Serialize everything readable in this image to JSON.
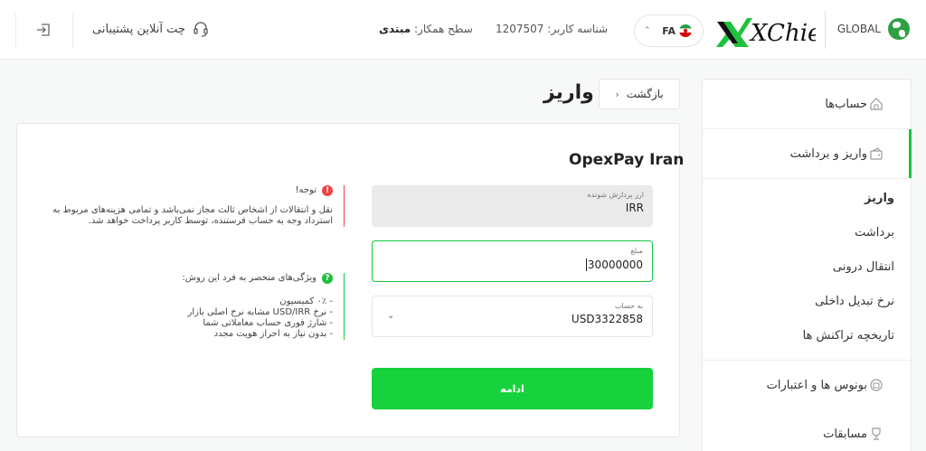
{
  "header": {
    "global_label": "GLOBAL",
    "logo_text": "XChief",
    "language": "FA",
    "user_id_label": "شناسه کاربر:",
    "user_id": "1207507",
    "partner_level_label": "سطح همکار:",
    "partner_level": "مبتدی",
    "support_label": "چت آنلاین پشتیبانی"
  },
  "sidebar": {
    "items": [
      {
        "label": "حساب‌ها",
        "icon": "home-icon"
      },
      {
        "label": "واریز و برداشت",
        "icon": "wallet-icon"
      }
    ],
    "sub_items": [
      {
        "label": "واریز"
      },
      {
        "label": "برداشت"
      },
      {
        "label": "انتقال درونی"
      },
      {
        "label": "نرخ تبدیل داخلی"
      },
      {
        "label": "تاریخچه تراکنش ها"
      }
    ],
    "bottom_items": [
      {
        "label": "بونوس ها و اعتبارات",
        "icon": "bonus-icon"
      },
      {
        "label": "مسابقات",
        "icon": "trophy-icon"
      }
    ]
  },
  "page": {
    "title": "واریز",
    "back_label": "بازگشت"
  },
  "form": {
    "title": "OpexPay Iran",
    "currency_label": "ارز پردازش شونده",
    "currency_value": "IRR",
    "amount_label": "مبلغ",
    "amount_value": "30000000",
    "account_label": "به حساب",
    "account_value": "USD3322858",
    "continue_label": "ادامه"
  },
  "notes": {
    "warning_title": "توجه!",
    "warning_text": "نقل و انتقالات از اشخاص ثالث مجاز نمی‌باشد و تمامی هزینه‌های مربوط به استرداد وجه به حساب فرستنده، توسط کاربر پرداخت خواهد شد.",
    "features_title": "ویژگی‌های منحصر به فرد این روش:",
    "features": [
      "- ۰٪ کمیسیون",
      "- نرخ USD/IRR مشابه نرخ اصلی بازار",
      "- شارژ فوری حساب معاملاتی شما",
      "- بدون نیاز به احراز هویت مجدد"
    ]
  },
  "colors": {
    "accent": "#17d23c",
    "warning": "#ee4444"
  }
}
